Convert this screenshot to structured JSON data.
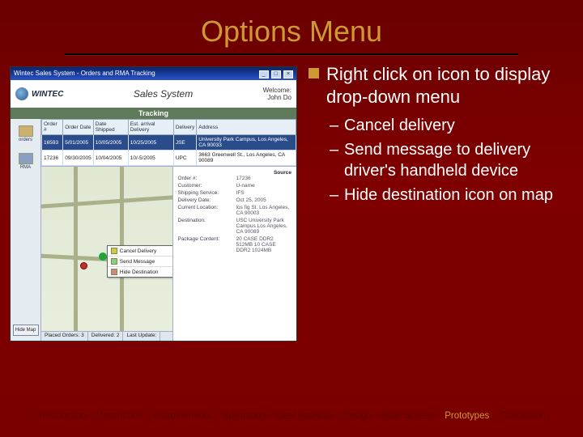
{
  "title": "Options Menu",
  "main_bullet": "Right click on icon to display drop-down menu",
  "sub_bullets": [
    "Cancel delivery",
    "Send message to delivery driver's handheld device",
    "Hide destination icon on map"
  ],
  "breadcrumb": {
    "items": [
      "Introduction",
      "Description",
      "Requirements",
      "Navigation",
      "User Analysis",
      "Design",
      "Main Screen",
      "Prototypes",
      "Conclusion"
    ],
    "sep": " – ",
    "active_index": 7
  },
  "window": {
    "title": "Wintec Sales System - Orders and RMA Tracking",
    "brand": "WINTEC",
    "header_center": "Sales System",
    "welcome_label": "Welcome:",
    "welcome_user": "John Do",
    "section_bar": "Tracking",
    "sidebar": {
      "orders": "orders",
      "rma": "RMA",
      "hide_map": "Hide Map"
    },
    "orders_table": {
      "headers": [
        "Order #",
        "Order Date",
        "Date Shipped",
        "Est. arrival Delivery",
        "Delivery",
        "Address"
      ],
      "rows": [
        {
          "cells": [
            "16593",
            "5/01/2005",
            "10/05/2005",
            "10/25/2005",
            "JSE",
            "University Park Campus, Los Angeles, CA 90033"
          ],
          "selected": true
        },
        {
          "cells": [
            "17236",
            "09/30/2005",
            "10/04/2005",
            "10/-5/2005",
            "UPC",
            "3663 Greenwell St., Los Angeles, CA 90089"
          ],
          "selected": false
        }
      ]
    },
    "context_menu": {
      "items": [
        {
          "icon": "bell-icon",
          "label": "Cancel Delivery"
        },
        {
          "icon": "msg-icon",
          "label": "Send Message"
        },
        {
          "icon": "hide-icon",
          "label": "Hide Destination"
        }
      ]
    },
    "map_status": {
      "placed": "Placed Orders: 3",
      "delivered": "Delivered: 2",
      "last": "Last Update:"
    },
    "details": {
      "source_label": "Source",
      "rows": [
        {
          "label": "Order #:",
          "value": "17236"
        },
        {
          "label": "Customer:",
          "value": "U-name"
        },
        {
          "label": "Shipping Service:",
          "value": "IFS"
        },
        {
          "label": "Delivery Date:",
          "value": "Oct 25, 2005"
        },
        {
          "label": "Current Location:",
          "value": "los fig St.\nLos Angeles, CA 90003"
        },
        {
          "label": "Destination:",
          "value": "USC\nUniversity Park Campus\nLos Angeles, CA 90089"
        },
        {
          "label": "Package Content:",
          "value": "20 CASE DDR2 512MB\n10 CASE DDR2 1024MB"
        }
      ]
    }
  }
}
